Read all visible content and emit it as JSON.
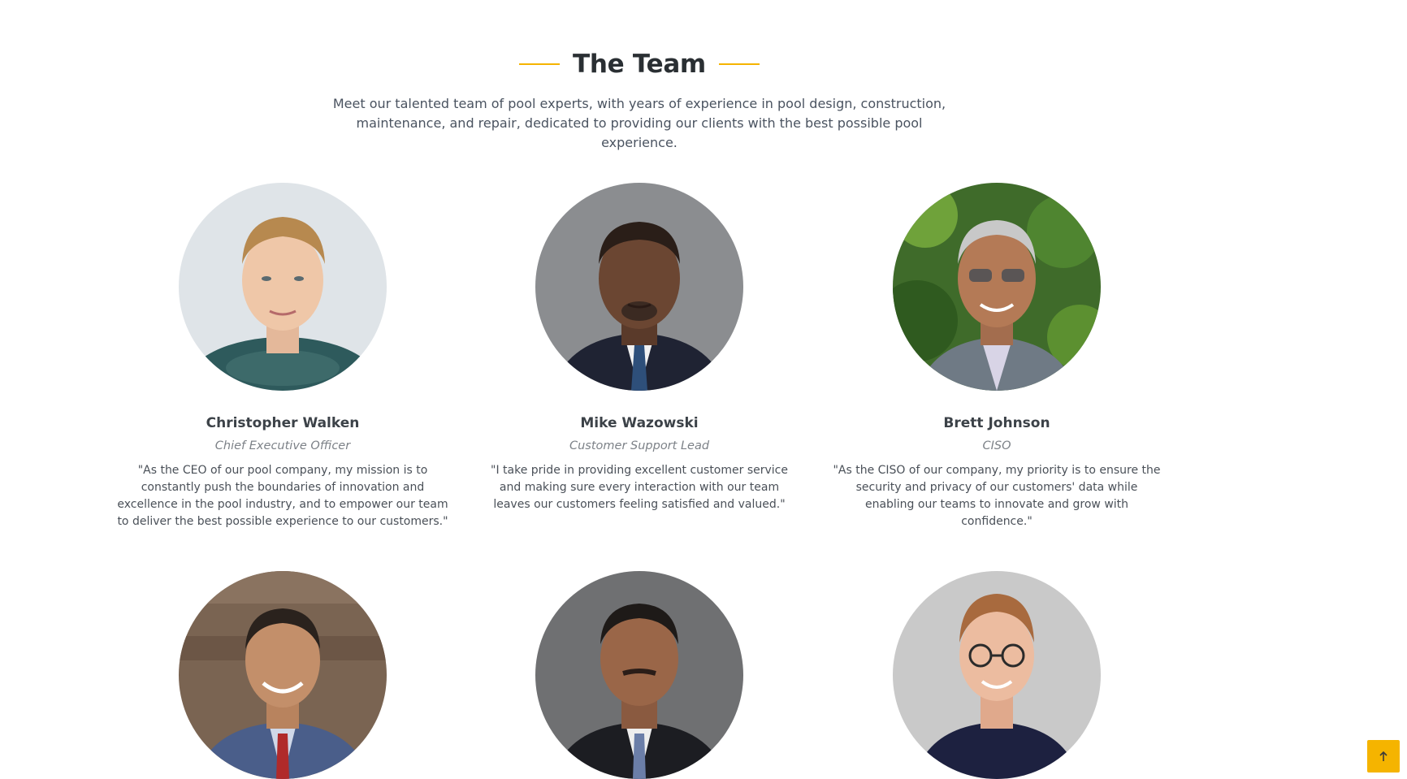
{
  "section": {
    "title": "The Team",
    "subtitle_line1": "Meet our talented team of pool experts, with years of experience in pool design, construction,",
    "subtitle_line2": "maintenance, and repair, dedicated to providing our clients with the best possible pool experience."
  },
  "team": [
    {
      "name": "Christopher Walken",
      "role": "Chief Executive Officer",
      "quote": "\"As the CEO of our pool company, my mission is to constantly push the boundaries of innovation and excellence in the pool industry, and to empower our team to deliver the best possible experience to our customers.\""
    },
    {
      "name": "Mike Wazowski",
      "role": "Customer Support Lead",
      "quote": "\"I take pride in providing excellent customer service and making sure every interaction with our team leaves our customers feeling satisfied and valued.\""
    },
    {
      "name": "Brett Johnson",
      "role": "CISO",
      "quote": "\"As the CISO of our company, my priority is to ensure the security and privacy of our customers' data while enabling our teams to innovate and grow with confidence.\""
    }
  ],
  "colors": {
    "accent": "#f5b400",
    "heading": "#2a2f33",
    "text": "#4a5360",
    "role": "#7d8288"
  },
  "scroll_top": {
    "icon": "arrow-up-icon"
  }
}
